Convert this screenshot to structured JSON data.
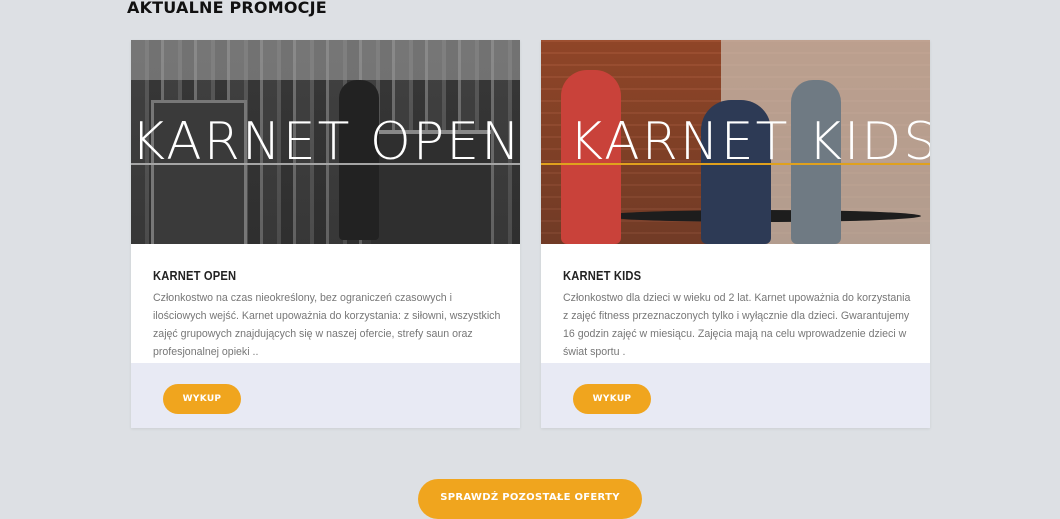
{
  "section": {
    "title": "AKTUALNE PROMOCJE"
  },
  "cards": [
    {
      "image_text": "KARNET OPEN",
      "title": "KARNET OPEN",
      "description": "Członkostwo na czas nieokreślony, bez ograniczeń czasowych i ilościowych wejść. Karnet upoważnia do korzystania: z siłowni, wszystkich zajęć grupowych znajdujących się w naszej ofercie, strefy saun oraz profesjonalnej opieki ..",
      "button": "WYKUP"
    },
    {
      "image_text": "KARNET KIDS",
      "title": "KARNET KIDS",
      "description": "Członkostwo dla dzieci w wieku od 2 lat. Karnet upoważnia do korzystania z zajęć fitness przeznaczonych tylko i wyłącznie dla dzieci. Gwarantujemy 16 godzin zajęć w miesiącu. Zajęcia mają na celu wprowadzenie dzieci w świat sportu .",
      "button": "WYKUP"
    }
  ],
  "more_offers": {
    "label": "SPRAWDŹ POZOSTAŁE OFERTY"
  },
  "colors": {
    "accent": "#f0a51e",
    "background": "#dde0e4",
    "card_footer": "#e8eaf4"
  }
}
